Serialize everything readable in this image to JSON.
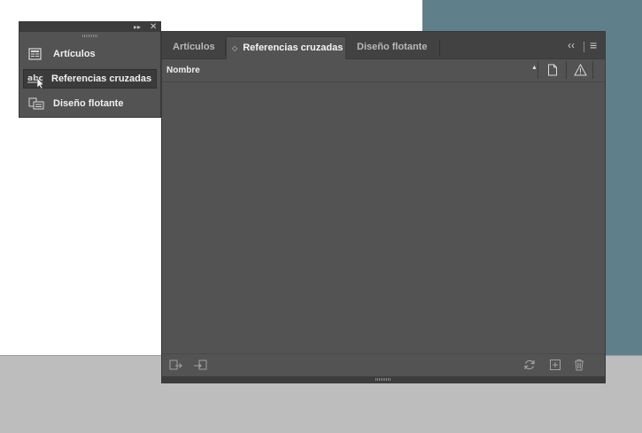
{
  "dock": {
    "items": [
      {
        "label": "Artículos",
        "icon": "articles-icon"
      },
      {
        "label": "Referencias cruzadas",
        "icon": "cross-references-icon"
      },
      {
        "label": "Diseño flotante",
        "icon": "liquid-layout-icon"
      }
    ],
    "expand_glyph": "▸▸",
    "close_glyph": "✕"
  },
  "panel": {
    "tabs": [
      {
        "label": "Artículos"
      },
      {
        "label": "Referencias cruzadas",
        "prefix": "◇"
      },
      {
        "label": "Diseño flotante"
      }
    ],
    "active_tab": "Referencias cruzadas",
    "collapse_glyph": "‹‹",
    "menu_glyph": "≡",
    "column": {
      "name": "Nombre",
      "sort_glyph": "▲"
    }
  },
  "colors": {
    "panel_bg": "#535353",
    "tab_bar": "#424242",
    "accent_teal": "#5f808a"
  }
}
